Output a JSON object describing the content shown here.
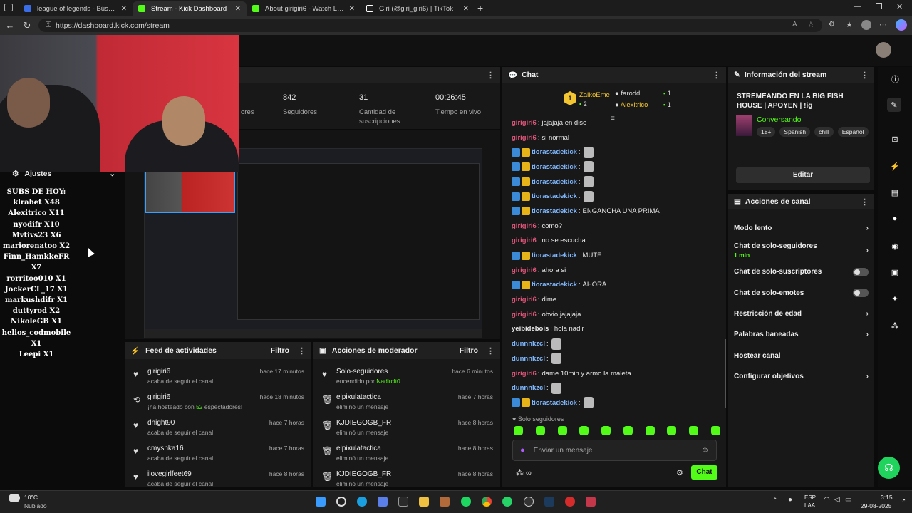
{
  "browser": {
    "tabs": [
      {
        "title": "league of legends - Búsqueda",
        "icon": "search-icon",
        "color": "#3a6ee8"
      },
      {
        "title": "Stream - Kick Dashboard",
        "icon": "kick-icon",
        "color": "#53fc18"
      },
      {
        "title": "About girigiri6 - Watch Live on Ki",
        "icon": "kick-icon",
        "color": "#53fc18"
      },
      {
        "title": "Giri (@giri_giri6) | TikTok",
        "icon": "tiktok-icon",
        "color": "#ffffff"
      }
    ],
    "url": "https://dashboard.kick.com/stream"
  },
  "stats": [
    {
      "value": "",
      "label": "ores"
    },
    {
      "value": "842",
      "label": "Seguidores"
    },
    {
      "value": "31",
      "label": "Cantidad de suscripciones"
    },
    {
      "value": "00:26:45",
      "label": "Tiempo en vivo"
    }
  ],
  "settings": {
    "label": "Ajustes"
  },
  "overlay": {
    "title": "SUBS DE HOY:",
    "lines": [
      "klrabet X48",
      "Alexitrico X11",
      "nyodifr X10",
      "Mvtivs23 X6",
      "mariorenatoo X2",
      "Finn_HamkkeFR X7",
      "rorritoo010 X1",
      "JockerCL_17 X1",
      "markushdifr X1",
      "duttyrod X2",
      "NikoleGB X1",
      "helios_codmobile X1",
      "Leepi X1"
    ]
  },
  "feed": {
    "title": "Feed de actividades",
    "filter": "Filtro",
    "items": [
      {
        "icon": "heart-icon",
        "user": "girigiri6",
        "text": "acaba de seguir el canal",
        "time": "hace 17 minutos"
      },
      {
        "icon": "host-icon",
        "user": "girigiri6",
        "text_pre": "¡ha hosteado con ",
        "count": "52",
        "text_post": " espectadores!",
        "time": "hace 18 minutos"
      },
      {
        "icon": "heart-icon",
        "user": "dnight90",
        "text": "acaba de seguir el canal",
        "time": "hace 7 horas"
      },
      {
        "icon": "heart-icon",
        "user": "cmyshka16",
        "text": "acaba de seguir el canal",
        "time": "hace 7 horas"
      },
      {
        "icon": "heart-icon",
        "user": "ilovegirlfeet69",
        "text": "acaba de seguir el canal",
        "time": "hace 8 horas"
      }
    ]
  },
  "mod": {
    "title": "Acciones de moderador",
    "filter": "Filtro",
    "items": [
      {
        "icon": "heart-icon",
        "user": "Solo-seguidores",
        "text_pre": "encendido por ",
        "by": "Nadirclt0",
        "time": "hace 6 minutos"
      },
      {
        "icon": "trash-icon",
        "user": "elpixulatactica",
        "text": "eliminó un mensaje",
        "time": "hace 7 horas"
      },
      {
        "icon": "trash-icon",
        "user": "KJDIEGOGB_FR",
        "text": "eliminó un mensaje",
        "time": "hace 8 horas"
      },
      {
        "icon": "trash-icon",
        "user": "elpixulatactica",
        "text": "eliminó un mensaje",
        "time": "hace 8 horas"
      },
      {
        "icon": "trash-icon",
        "user": "KJDIEGOGB_FR",
        "text": "eliminó un mensaje",
        "time": "hace 8 horas"
      }
    ]
  },
  "chat": {
    "title": "Chat",
    "leaders": [
      {
        "rank": "1",
        "name": "ZaikoEme",
        "count": "2"
      },
      {
        "name": "farodd",
        "count": "1"
      },
      {
        "name": "Alexitrico",
        "count": "1"
      }
    ],
    "messages": [
      {
        "user": "girigiri6",
        "color": "#e0557a",
        "text": "jajajaja en dise",
        "badges": 0
      },
      {
        "user": "girigiri6",
        "color": "#e0557a",
        "text": "si normal",
        "badges": 0
      },
      {
        "user": "tiorastadekick",
        "color": "#7fb8ff",
        "text": "",
        "badges": 2,
        "emote": true
      },
      {
        "user": "tiorastadekick",
        "color": "#7fb8ff",
        "text": "",
        "badges": 2,
        "emote": true
      },
      {
        "user": "tiorastadekick",
        "color": "#7fb8ff",
        "text": "",
        "badges": 2,
        "emote": true
      },
      {
        "user": "tiorastadekick",
        "color": "#7fb8ff",
        "text": "",
        "badges": 2,
        "emote": true
      },
      {
        "user": "tiorastadekick",
        "color": "#7fb8ff",
        "text": "ENGANCHA UNA PRIMA",
        "badges": 2
      },
      {
        "user": "girigiri6",
        "color": "#e0557a",
        "text": "como?",
        "badges": 0
      },
      {
        "user": "girigiri6",
        "color": "#e0557a",
        "text": "no se escucha",
        "badges": 0
      },
      {
        "user": "tiorastadekick",
        "color": "#7fb8ff",
        "text": "MUTE",
        "badges": 2
      },
      {
        "user": "girigiri6",
        "color": "#e0557a",
        "text": "ahora si",
        "badges": 0
      },
      {
        "user": "tiorastadekick",
        "color": "#7fb8ff",
        "text": "AHORA",
        "badges": 2
      },
      {
        "user": "girigiri6",
        "color": "#e0557a",
        "text": "dime",
        "badges": 0
      },
      {
        "user": "girigiri6",
        "color": "#e0557a",
        "text": "obvio jajajaja",
        "badges": 0
      },
      {
        "user": "yeibidebois",
        "color": "#e8e8e8",
        "text": "hola nadir",
        "badges": 0
      },
      {
        "user": "dunnnkzcl",
        "color": "#7fb8ff",
        "text": "",
        "badges": 0,
        "emote": true
      },
      {
        "user": "dunnnkzcl",
        "color": "#7fb8ff",
        "text": "",
        "badges": 0,
        "emote": true
      },
      {
        "user": "girigiri6",
        "color": "#e0557a",
        "text": "dame 10min y armo la maleta",
        "badges": 0
      },
      {
        "user": "dunnnkzcl",
        "color": "#7fb8ff",
        "text": "",
        "badges": 0,
        "emote": true
      },
      {
        "user": "tiorastadekick",
        "color": "#7fb8ff",
        "text": "",
        "badges": 2,
        "emote": true
      }
    ],
    "mode": "Solo seguidores",
    "placeholder": "Enviar un mensaje",
    "send": "Chat"
  },
  "info": {
    "title": "Información del stream",
    "stream_title": "STREMEANDO EN LA BIG FISH HOUSE | APOYEN | !ig",
    "category": "Conversando",
    "tags": [
      "18+",
      "Spanish",
      "chill",
      "Español"
    ],
    "edit": "Editar"
  },
  "actions": {
    "title": "Acciones de canal",
    "items": [
      {
        "label": "Modo lento",
        "kind": "arrow"
      },
      {
        "label": "Chat de solo-seguidores",
        "sub": "1 min",
        "kind": "arrow"
      },
      {
        "label": "Chat de solo-suscriptores",
        "kind": "toggle"
      },
      {
        "label": "Chat de solo-emotes",
        "kind": "toggle"
      },
      {
        "label": "Restricción de edad",
        "kind": "arrow"
      },
      {
        "label": "Palabras baneadas",
        "kind": "arrow"
      },
      {
        "label": "Hostear canal",
        "kind": "none"
      },
      {
        "label": "Configurar objetivos",
        "kind": "arrow"
      }
    ]
  },
  "taskbar": {
    "temp": "10°C",
    "weather": "Nublado",
    "lang1": "ESP",
    "lang2": "LAA",
    "time": "3:15",
    "date": "29-08-2025"
  },
  "colors": {
    "accent": "#53fc18",
    "bg": "#0b0b0b",
    "panel": "#181818"
  }
}
